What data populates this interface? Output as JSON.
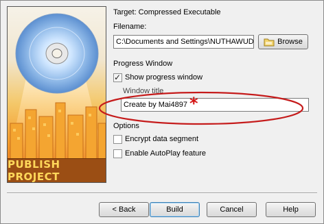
{
  "banner": {
    "title": "PUBLISH PROJECT"
  },
  "target": {
    "label": "Target: Compressed Executable"
  },
  "filename": {
    "label": "Filename:",
    "value": "C:\\Documents and Settings\\NUTHAWUD",
    "browse_label": "Browse"
  },
  "progress": {
    "section_label": "Progress Window",
    "show_label": "Show progress window",
    "show_checked": true,
    "title_label": "Window title",
    "title_value": "Create by Mai4897"
  },
  "annotation": {
    "star": "*",
    "color": "#d41414"
  },
  "options": {
    "section_label": "Options",
    "encrypt_label": "Encrypt data segment",
    "encrypt_checked": false,
    "autoplay_label": "Enable AutoPlay feature",
    "autoplay_checked": false
  },
  "buttons": {
    "back": "< Back",
    "build": "Build",
    "cancel": "Cancel",
    "help": "Help"
  },
  "colors": {
    "banner_title_bg": "#9b4e14",
    "banner_title_fg": "#ffd85a",
    "accent_blue": "#3c7fb1"
  }
}
